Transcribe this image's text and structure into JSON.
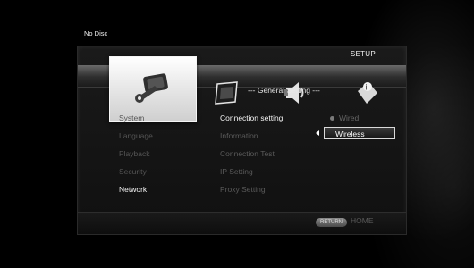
{
  "status": {
    "disc": "No Disc"
  },
  "header": {
    "title": "SETUP",
    "section": "--- General Setting ---"
  },
  "tabs": [
    {
      "name": "general-setting",
      "icon": "wrench-settings-icon",
      "selected": true
    },
    {
      "name": "display-setting",
      "icon": "display-panel-icon",
      "selected": false
    },
    {
      "name": "audio-setting",
      "icon": "speaker-audio-icon",
      "selected": false
    },
    {
      "name": "system-information",
      "icon": "info-icon",
      "selected": false
    }
  ],
  "menu": {
    "categories": [
      "System",
      "Language",
      "Playback",
      "Security",
      "Network"
    ],
    "active_category": "Network",
    "items": [
      "Connection setting",
      "Information",
      "Connection Test",
      "IP Setting",
      "Proxy Setting"
    ],
    "active_item": "Connection setting"
  },
  "options": {
    "wired": "Wired",
    "wireless": "Wireless",
    "selected": "Wireless"
  },
  "footer": {
    "return_label": "RETURN",
    "home_label": "HOME"
  }
}
